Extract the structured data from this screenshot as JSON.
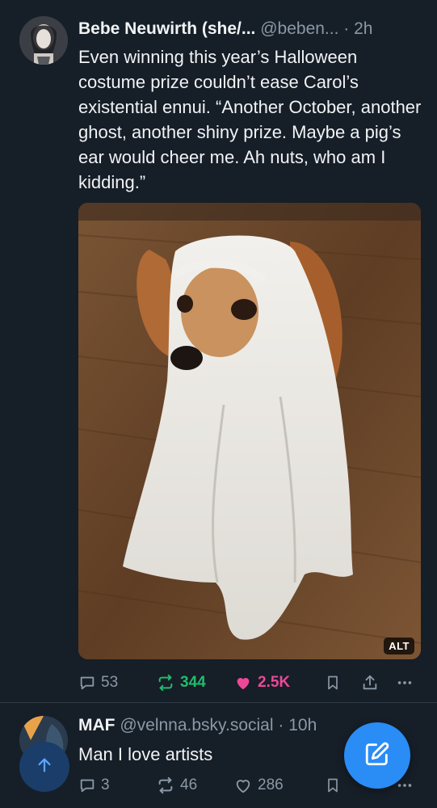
{
  "colors": {
    "background": "#161e27",
    "text": "#f1f3f5",
    "muted": "#8b98a7",
    "repost_active": "#20bc6d",
    "like_active": "#ec4899",
    "accent": "#2a8cf5"
  },
  "feed": {
    "posts": [
      {
        "display_name": "Bebe Neuwirth (she/...",
        "handle": "@beben...",
        "separator": "·",
        "time": "2h",
        "text": "Even winning this year’s Halloween costume prize couldn’t ease Carol’s existential ennui. “Another October, another ghost, another shiny prize. Maybe a pig’s ear would cheer me. Ah nuts, who am I kidding.”",
        "media": {
          "description": "photo",
          "alt_badge": "ALT"
        },
        "counts": {
          "replies": "53",
          "reposts": "344",
          "likes": "2.5K"
        },
        "reposted": true,
        "liked": true,
        "icons": [
          "reply-icon",
          "repost-icon",
          "heart-icon",
          "bookmark-icon",
          "share-icon",
          "more-icon"
        ]
      },
      {
        "display_name": "MAF",
        "handle": "@velnna.bsky.social",
        "separator": "·",
        "time": "10h",
        "text": "Man I love artists",
        "counts": {
          "replies": "3",
          "reposts": "46",
          "likes": "286"
        },
        "reposted": false,
        "liked": false,
        "icons": [
          "reply-icon",
          "repost-icon",
          "heart-icon",
          "bookmark-icon",
          "share-icon",
          "more-icon"
        ]
      }
    ]
  },
  "floating": {
    "scroll_top_icon": "arrow-up-icon",
    "compose_icon": "compose-icon"
  }
}
